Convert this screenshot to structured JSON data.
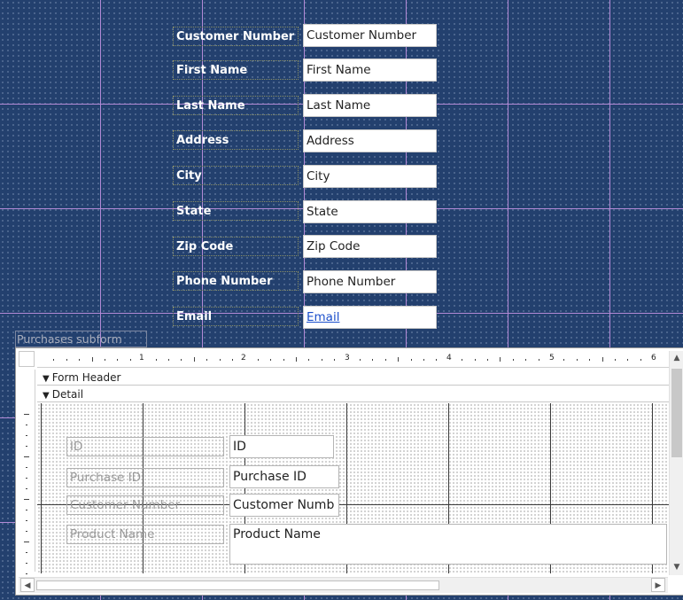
{
  "main_form": {
    "fields": [
      {
        "label": "Customer Number",
        "value": "Customer Number"
      },
      {
        "label": "First Name",
        "value": "First Name"
      },
      {
        "label": "Last Name",
        "value": "Last Name"
      },
      {
        "label": "Address",
        "value": "Address"
      },
      {
        "label": "City",
        "value": "City"
      },
      {
        "label": "State",
        "value": "State"
      },
      {
        "label": "Zip Code",
        "value": "Zip Code"
      },
      {
        "label": "Phone Number",
        "value": "Phone Number"
      },
      {
        "label": "Email",
        "value": "Email"
      }
    ]
  },
  "subform": {
    "label": "Purchases subform",
    "ruler_numbers": [
      "1",
      "2",
      "3",
      "4",
      "5",
      "6"
    ],
    "sections": {
      "form_header": "Form Header",
      "detail": "Detail"
    },
    "fields": [
      {
        "label": "ID",
        "value": "ID"
      },
      {
        "label": "Purchase ID",
        "value": "Purchase ID"
      },
      {
        "label": "Customer Number",
        "value": "Customer Numb"
      },
      {
        "label": "Product Name",
        "value": "Product Name"
      }
    ]
  },
  "icons": {
    "section_arrow": "▼",
    "scroll_up": "▲",
    "scroll_down": "▼",
    "scroll_left": "◀",
    "scroll_right": "▶"
  },
  "colors": {
    "canvas": "#23406e",
    "grid_line": "#b28ad6",
    "link": "#1b4fcc"
  }
}
